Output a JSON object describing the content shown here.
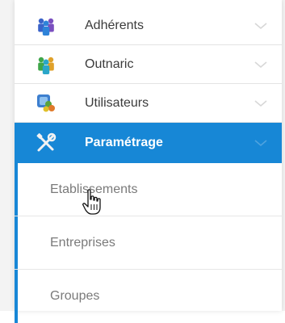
{
  "menu": {
    "items": [
      {
        "label": "Adhérents",
        "icon": "members-group-icon"
      },
      {
        "label": "Outnaric",
        "icon": "members-group-icon"
      },
      {
        "label": "Utilisateurs",
        "icon": "users-icon"
      },
      {
        "label": "Paramétrage",
        "icon": "tools-icon",
        "active": true
      }
    ],
    "submenu": [
      {
        "label": "Etablissements"
      },
      {
        "label": "Entreprises"
      },
      {
        "label": "Groupes"
      }
    ]
  },
  "colors": {
    "accent": "#1787d6",
    "text": "#3b3b3b",
    "subtext": "#7a7a7a"
  }
}
